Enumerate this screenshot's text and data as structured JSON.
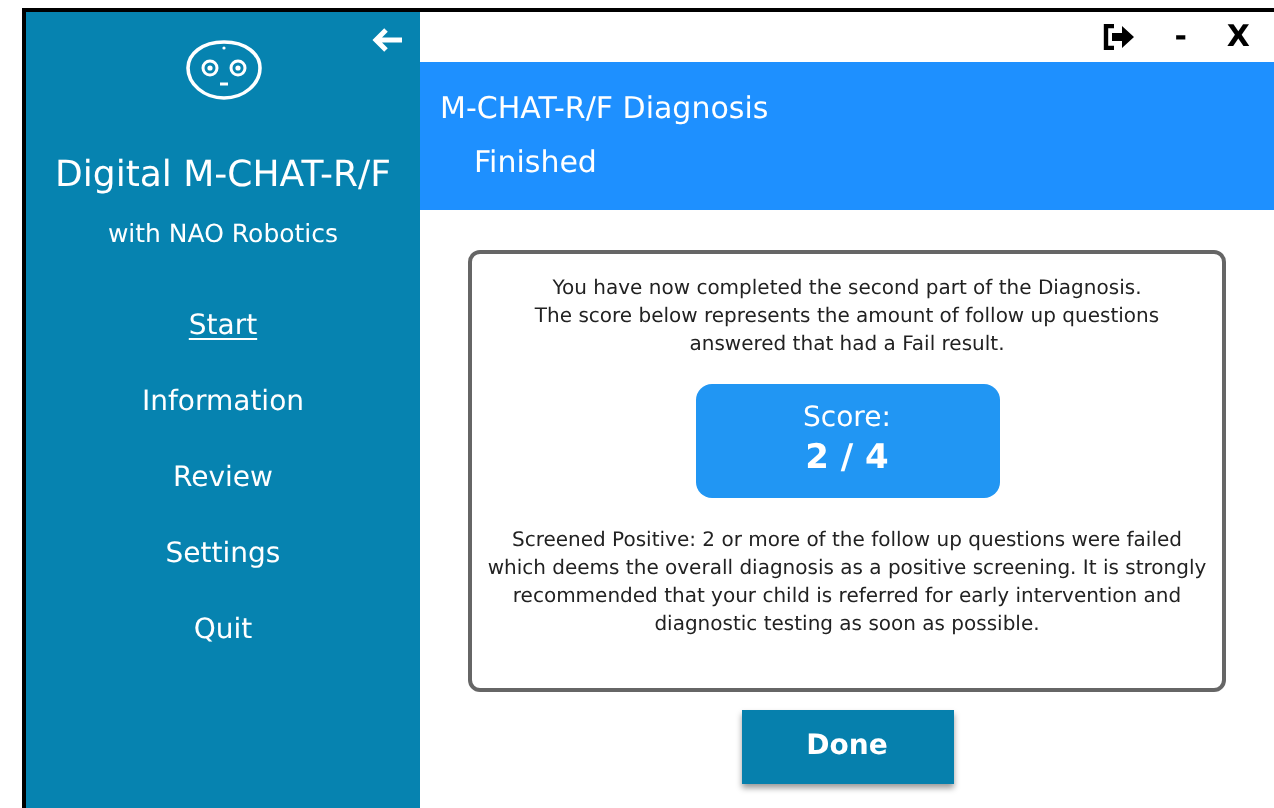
{
  "sidebar": {
    "title": "Digital M-CHAT-R/F",
    "subtitle": "with NAO Robotics",
    "items": [
      {
        "label": "Start",
        "selected": true
      },
      {
        "label": "Information",
        "selected": false
      },
      {
        "label": "Review",
        "selected": false
      },
      {
        "label": "Settings",
        "selected": false
      },
      {
        "label": "Quit",
        "selected": false
      }
    ]
  },
  "window_controls": {
    "minimize": "-",
    "close": "X"
  },
  "header": {
    "title": "M-CHAT-R/F Diagnosis",
    "subtitle": "Finished"
  },
  "card": {
    "intro": "You have now completed the second part of the Diagnosis.\nThe score below represents the amount of follow up questions answered that had a Fail result.",
    "score_label": "Score:",
    "score_value": "2 / 4",
    "result": "Screened Positive: 2 or more of the follow up questions were failed which deems the overall diagnosis as a positive screening. It is strongly recommended that your child is referred for early intervention and diagnostic testing as soon as possible."
  },
  "done_button": "Done"
}
